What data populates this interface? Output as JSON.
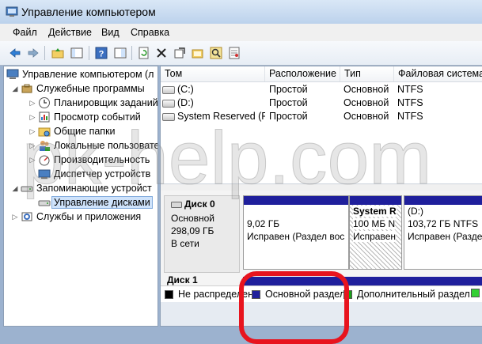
{
  "window": {
    "title": "Управление компьютером"
  },
  "menu": [
    "Файл",
    "Действие",
    "Вид",
    "Справка"
  ],
  "toolbar": {
    "buttons": [
      "back-icon",
      "forward-icon",
      "up-folder-icon",
      "show-hide-tree-icon",
      "help-icon",
      "properties-pane-icon",
      "refresh-icon",
      "delete-icon",
      "properties-icon",
      "open-icon",
      "search-icon",
      "wizard-icon"
    ]
  },
  "tree": {
    "root": "Управление компьютером (л",
    "utilities": "Служебные программы",
    "task_scheduler": "Планировщик заданий",
    "event_viewer": "Просмотр событий",
    "shared_folders": "Общие папки",
    "local_users": "Локальные пользовате",
    "performance": "Производительность",
    "device_manager": "Диспетчер устройств",
    "storage": "Запоминающие устройст",
    "disk_management": "Управление дисками",
    "services": "Службы и приложения"
  },
  "volume_list": {
    "columns": [
      "Том",
      "Расположение",
      "Тип",
      "Файловая система"
    ],
    "rows": [
      {
        "volume": "(C:)",
        "layout": "Простой",
        "type": "Основной",
        "fs": "NTFS"
      },
      {
        "volume": "(D:)",
        "layout": "Простой",
        "type": "Основной",
        "fs": "NTFS"
      },
      {
        "volume": "System Reserved (F:)",
        "layout": "Простой",
        "type": "Основной",
        "fs": "NTFS"
      }
    ]
  },
  "watermark": "pk-help.com",
  "disk0": {
    "name": "Диск 0",
    "type": "Основной",
    "size": "298,09 ГБ",
    "status": "В сети",
    "partitions": [
      {
        "line1": "9,02 ГБ",
        "line2": "Исправен (Раздел вос"
      },
      {
        "line1": "System R",
        "line2": "100 МБ N",
        "line3": "Исправен"
      },
      {
        "line1": "(D:)",
        "line2": "103,72 ГБ NTFS",
        "line3": "Исправен (Раздел"
      }
    ]
  },
  "disk1": {
    "name": "Диск 1"
  },
  "legend": [
    {
      "label": "Не распределен",
      "color": "#000000"
    },
    {
      "label": "Основной раздел",
      "color": "#1f1f9c"
    },
    {
      "label": "Дополнительный раздел",
      "color": "#1aa01a"
    },
    {
      "label": "",
      "color": "#33d033"
    }
  ],
  "highlight_color": "#e8141e"
}
